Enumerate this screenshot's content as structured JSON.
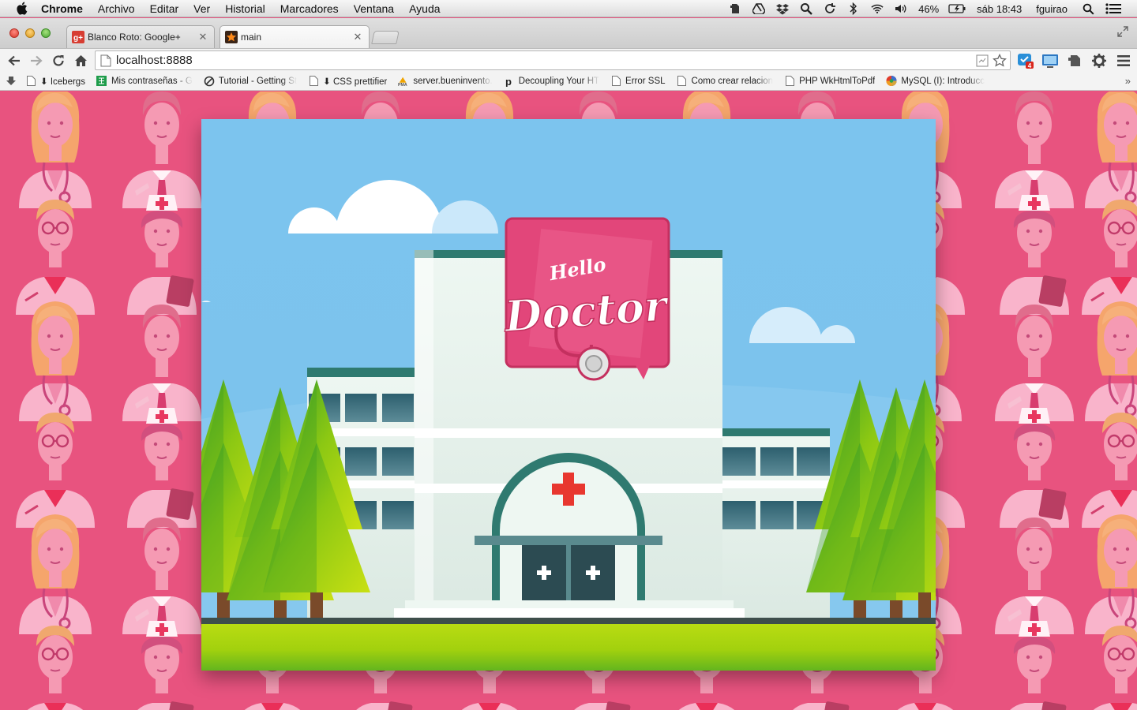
{
  "menubar": {
    "app_name": "Chrome",
    "menus": [
      "Archivo",
      "Editar",
      "Ver",
      "Historial",
      "Marcadores",
      "Ventana",
      "Ayuda"
    ],
    "status": {
      "battery": "46%",
      "clock": "sáb 18:43",
      "user": "fguirao"
    }
  },
  "tabs": [
    {
      "title": "Blanco Roto: Google+",
      "icon": "google-plus-icon",
      "active": false
    },
    {
      "title": "main",
      "icon": "star-icon",
      "active": true
    }
  ],
  "address_bar": {
    "url": "localhost:8888"
  },
  "extensions": {
    "badge_count": "4"
  },
  "bookmarks": [
    {
      "label": "⬇ Icebergs",
      "icon": "page-icon"
    },
    {
      "label": "Mis contraseñas - G",
      "icon": "spreadsheet-icon"
    },
    {
      "label": "Tutorial - Getting St",
      "icon": "gear-link-icon"
    },
    {
      "label": "⬇ CSS prettifier",
      "icon": "page-icon"
    },
    {
      "label": "server.bueninvento.",
      "icon": "pma-icon"
    },
    {
      "label": "Decoupling Your HT",
      "icon": "p-icon"
    },
    {
      "label": "Error SSL",
      "icon": "page-icon"
    },
    {
      "label": "Como crear relacion",
      "icon": "page-icon"
    },
    {
      "label": "PHP WkHtmlToPdf",
      "icon": "page-icon"
    },
    {
      "label": "MySQL (I): Introducc",
      "icon": "mysql-icon"
    }
  ],
  "bookmarks_overflow": "»",
  "content": {
    "logo_small": "Hello",
    "logo_large": "Doctor",
    "background_color": "#e8537f",
    "sky_color": "#7cc4ee",
    "brand_pink": "#e2467a"
  }
}
